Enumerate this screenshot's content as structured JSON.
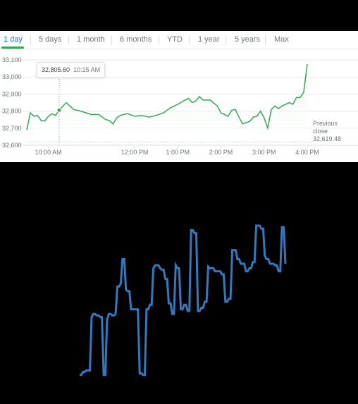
{
  "tabs": [
    "1 day",
    "5 days",
    "1 month",
    "6 months",
    "YTD",
    "1 year",
    "5 years",
    "Max"
  ],
  "active_tab": "1 day",
  "tooltip": {
    "value": "32,805.60",
    "time": "10:15 AM"
  },
  "previous_close": {
    "label_line1": "Previous",
    "label_line2": "close",
    "value": "32,619.48"
  },
  "colors": {
    "line": "#34a853",
    "area": "#e6f4ea",
    "grid": "#e8eaed",
    "tab_active": "#1a73e8",
    "lower_line": "#2e7bbf",
    "background_lower": "#000000"
  },
  "chart_data": [
    {
      "type": "area",
      "y_ticks": [
        "33,100",
        "33,000",
        "32,900",
        "32,800",
        "32,700",
        "32,600"
      ],
      "x_ticks": [
        "10:00 AM",
        "12:00 PM",
        "1:00 PM",
        "2:00 PM",
        "3:00 PM",
        "4:00 PM"
      ],
      "ylim": [
        32600,
        33100
      ],
      "xlim": [
        "9:30 AM",
        "4:00 PM"
      ],
      "grid": true,
      "x": [
        "9:30",
        "9:35",
        "9:40",
        "9:45",
        "9:50",
        "9:55",
        "10:00",
        "10:05",
        "10:10",
        "10:15",
        "10:25",
        "10:35",
        "10:45",
        "11:00",
        "11:10",
        "11:20",
        "11:25",
        "11:30",
        "11:35",
        "11:40",
        "11:50",
        "12:00",
        "12:10",
        "12:20",
        "12:30",
        "12:40",
        "12:50",
        "1:00",
        "1:10",
        "1:15",
        "1:20",
        "1:25",
        "1:30",
        "1:35",
        "1:45",
        "1:55",
        "2:00",
        "2:10",
        "2:15",
        "2:20",
        "2:25",
        "2:30",
        "2:40",
        "2:45",
        "2:50",
        "2:55",
        "3:00",
        "3:05",
        "3:10",
        "3:15",
        "3:20",
        "3:25",
        "3:35",
        "3:40",
        "3:45",
        "3:50",
        "3:55",
        "4:00"
      ],
      "values": [
        32690,
        32790,
        32770,
        32775,
        32745,
        32742,
        32770,
        32785,
        32775,
        32805.6,
        32850,
        32810,
        32800,
        32780,
        32780,
        32750,
        32745,
        32725,
        32760,
        32775,
        32785,
        32770,
        32775,
        32765,
        32775,
        32790,
        32820,
        32840,
        32865,
        32875,
        32850,
        32860,
        32885,
        32865,
        32865,
        32830,
        32790,
        32770,
        32805,
        32810,
        32765,
        32725,
        32740,
        32765,
        32770,
        32800,
        32760,
        32700,
        32810,
        32830,
        32815,
        32830,
        32850,
        32840,
        32880,
        32880,
        32910,
        33075
      ],
      "reference_line": {
        "label": "Previous close",
        "value": 32619.48
      }
    },
    {
      "type": "line",
      "y_axis_visible": false,
      "x_axis_visible": false,
      "ylim": [
        0,
        100
      ],
      "values": [
        2,
        2,
        4,
        4,
        5,
        5,
        5,
        40,
        42,
        42,
        41,
        41,
        40,
        40,
        2,
        2,
        38,
        42,
        42,
        41,
        41,
        42,
        60,
        60,
        62,
        78,
        78,
        58,
        57,
        57,
        45,
        45,
        45,
        45,
        45,
        3,
        3,
        2,
        2,
        45,
        45,
        48,
        48,
        72,
        74,
        74,
        74,
        72,
        71,
        71,
        65,
        65,
        49,
        49,
        42,
        42,
        74,
        72,
        72,
        45,
        45,
        48,
        48,
        44,
        44,
        97,
        97,
        95,
        95,
        44,
        44,
        46,
        46,
        50,
        50,
        73,
        72,
        72,
        72,
        70,
        70,
        70,
        70,
        68,
        68,
        50,
        50,
        52,
        52,
        84,
        84,
        84,
        78,
        78,
        75,
        75,
        75,
        70,
        70,
        72,
        72,
        76,
        76,
        100,
        100,
        100,
        98,
        98,
        80,
        78,
        78,
        75,
        75,
        75,
        74,
        74,
        70,
        70,
        99,
        99,
        75
      ]
    }
  ]
}
